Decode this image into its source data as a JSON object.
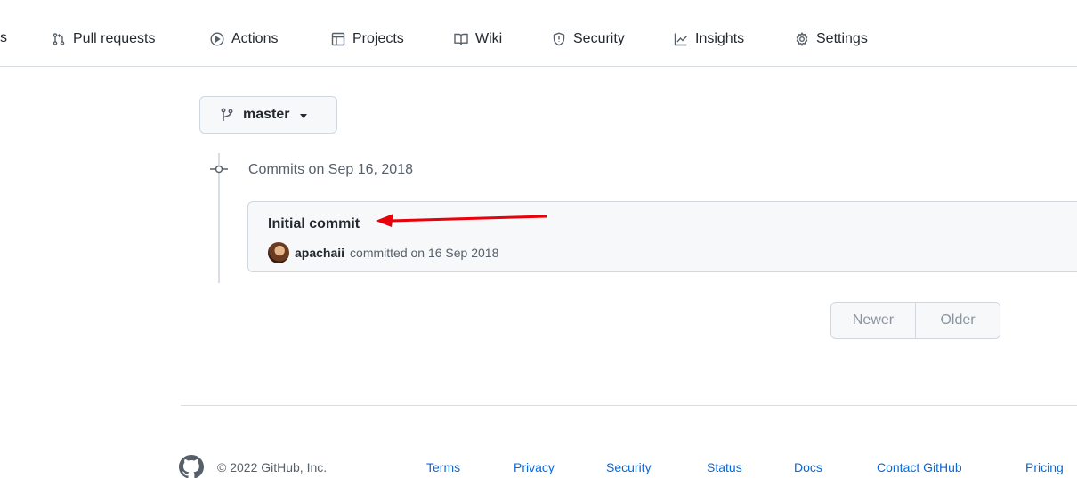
{
  "nav": {
    "cut_item": "s",
    "items": [
      {
        "label": "Pull requests",
        "icon": "pull-request-icon"
      },
      {
        "label": "Actions",
        "icon": "play-icon"
      },
      {
        "label": "Projects",
        "icon": "table-icon"
      },
      {
        "label": "Wiki",
        "icon": "book-icon"
      },
      {
        "label": "Security",
        "icon": "shield-icon"
      },
      {
        "label": "Insights",
        "icon": "graph-icon"
      },
      {
        "label": "Settings",
        "icon": "gear-icon"
      }
    ]
  },
  "branch": {
    "name": "master",
    "icon": "git-branch-icon"
  },
  "commits_heading": "Commits on Sep 16, 2018",
  "commit": {
    "title": "Initial commit",
    "author": "apachaii",
    "meta": "committed on 16 Sep 2018"
  },
  "annotation": {
    "arrow_color": "#e8000b"
  },
  "pagination": {
    "newer": "Newer",
    "older": "Older"
  },
  "footer": {
    "copyright": "© 2022 GitHub, Inc.",
    "links": [
      "Terms",
      "Privacy",
      "Security",
      "Status",
      "Docs",
      "Contact GitHub",
      "Pricing"
    ]
  },
  "colors": {
    "link": "#0969da",
    "text": "#24292f",
    "muted": "#57606a",
    "border": "#d0d7de"
  }
}
